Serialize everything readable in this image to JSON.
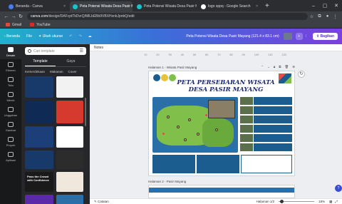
{
  "browser": {
    "tabs": [
      {
        "label": "Beranda - Canva",
        "color": "#4a7cf0"
      },
      {
        "label": "Peta Potensi Wisata Desa Pasir M...",
        "color": "#19c3c9"
      },
      {
        "label": "Peta Potensi Wisata Desa Pasir M...",
        "color": "#19c3c9"
      },
      {
        "label": "logo sppq - Google Search",
        "color": "#ffffff"
      }
    ],
    "new_tab": "+",
    "url_domain": "canva.com",
    "url_path": "/design/DAFcptTkDvrQ/MlLbEBb9VBXHxnkJpnbQ/edit",
    "bookmarks": [
      {
        "label": "Gmail",
        "color": "#e04a3a"
      },
      {
        "label": "YouTube",
        "color": "#e02a2a"
      }
    ]
  },
  "toolbar": {
    "home": "Beranda",
    "file": "File",
    "resize": "Ubah ukuran",
    "doc_title": "Peta Potensi Wisata Desa Pasir Mayang (121.4 x 83.1 cm)",
    "share": "Bagikan"
  },
  "rail": [
    {
      "label": "Desain"
    },
    {
      "label": "Elemen"
    },
    {
      "label": "Teks"
    },
    {
      "label": "Merek"
    },
    {
      "label": "Unggahan"
    },
    {
      "label": "Gambar"
    },
    {
      "label": "Proyek"
    },
    {
      "label": "Aplikasi"
    }
  ],
  "panel": {
    "search_placeholder": "Cari template",
    "tabs": [
      "Template",
      "Gaya"
    ],
    "chips": [
      "Kemerdekaan",
      "Makanan",
      "Cover"
    ],
    "thumbs": [
      {
        "title": "",
        "bg": "#173a6b"
      },
      {
        "title": "",
        "bg": "#f2f2f2"
      },
      {
        "title": "",
        "bg": "#0f2b55"
      },
      {
        "title": "",
        "bg": "#d63a2e"
      },
      {
        "title": "",
        "bg": "#1c3f7a"
      },
      {
        "title": "",
        "bg": "#ffffff"
      },
      {
        "title": "",
        "bg": "#173a6b"
      },
      {
        "title": "",
        "bg": "#2c2c2c"
      },
      {
        "title": "Pass the Crowd with Confidence",
        "bg": "#1a1a1a"
      },
      {
        "title": "",
        "bg": "#f0e8dc"
      },
      {
        "title": "",
        "bg": "#5a2aa8"
      },
      {
        "title": "",
        "bg": "#2a6fa8"
      }
    ]
  },
  "workspace": {
    "notes": "Notes",
    "ruler": [
      "10",
      "20",
      "30",
      "40",
      "50",
      "60",
      "70",
      "80",
      "90",
      "100",
      "110",
      "120"
    ],
    "page1_label": "Halaman 1 - Wisata Pasir Mayang",
    "page2_label": "Halaman 2 - Pasir Mayang",
    "design_title_line1": "PETA PERSEBARAN WISATA",
    "design_title_line2": "DESA PASIR MAYANG",
    "colors": {
      "navy": "#1f2a6e",
      "sea": "#2a6fa8",
      "land": "#7fbf4a",
      "panel": "#1b5d8f",
      "accent": "#e84a4a"
    }
  },
  "status": {
    "notes": "Catatan",
    "pages": "Halaman 1/2",
    "zoom": "18%"
  }
}
